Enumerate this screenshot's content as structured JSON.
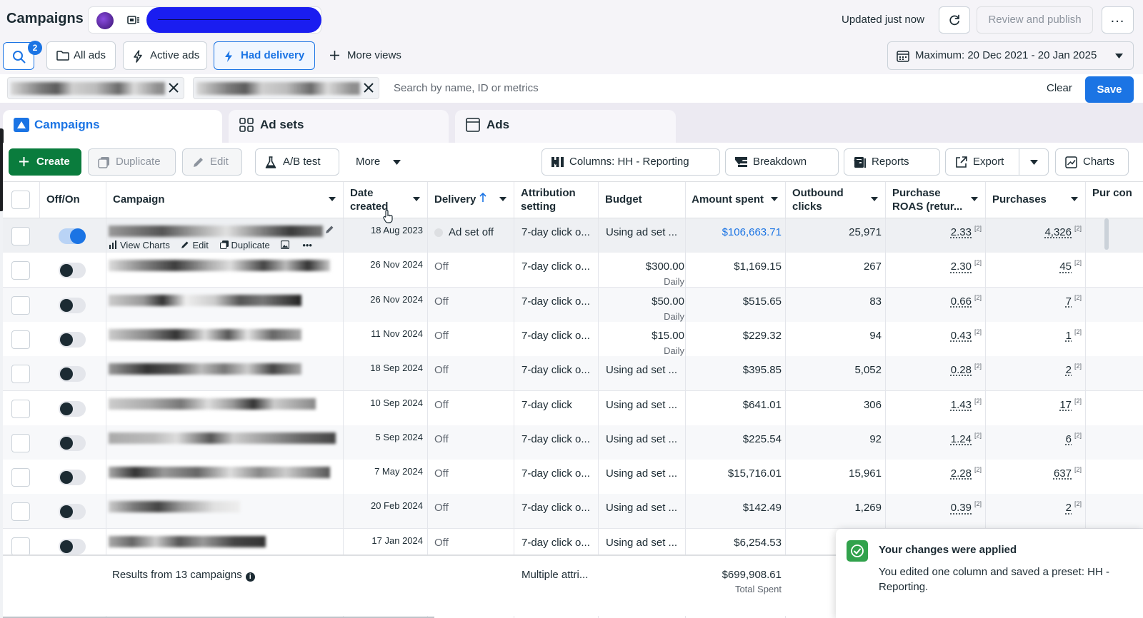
{
  "header": {
    "title": "Campaigns",
    "updated": "Updated just now",
    "review_label": "Review and publish",
    "more_label": "..."
  },
  "views": {
    "search_badge": "2",
    "all_ads": "All ads",
    "active_ads": "Active ads",
    "had_delivery": "Had delivery",
    "more_views": "More views",
    "date_range": "Maximum: 20 Dec 2021 - 20 Jan 2025"
  },
  "filters": {
    "search_placeholder": "Search by name, ID or metrics",
    "clear": "Clear",
    "save": "Save"
  },
  "tabs": {
    "campaigns": "Campaigns",
    "adsets": "Ad sets",
    "ads": "Ads"
  },
  "toolbar": {
    "create": "Create",
    "duplicate": "Duplicate",
    "edit": "Edit",
    "ab_test": "A/B test",
    "more": "More",
    "columns": "Columns: HH - Reporting",
    "breakdown": "Breakdown",
    "reports": "Reports",
    "export": "Export",
    "charts": "Charts"
  },
  "table": {
    "headers": {
      "offon": "Off/On",
      "campaign": "Campaign",
      "date_created": "Date created",
      "delivery": "Delivery",
      "attribution": "Attribution setting",
      "budget": "Budget",
      "amount_spent": "Amount spent",
      "outbound_clicks": "Outbound clicks",
      "roas": "Purchase ROAS (retur...",
      "purchases": "Purchases",
      "cut": "Pur con"
    },
    "row_actions": {
      "view_charts": "View Charts",
      "edit": "Edit",
      "duplicate": "Duplicate"
    },
    "rows": [
      {
        "on": true,
        "date": "18 Aug 2023",
        "delivery": "Ad set off",
        "attribution": "7-day click o...",
        "budget": "Using ad set ...",
        "budget_sub": "",
        "spent": "$106,663.71",
        "clicks": "25,971",
        "roas": "2.33",
        "purchases": "4,326"
      },
      {
        "on": false,
        "date": "26 Nov 2024",
        "delivery": "Off",
        "attribution": "7-day click o...",
        "budget": "$300.00",
        "budget_sub": "Daily",
        "spent": "$1,169.15",
        "clicks": "267",
        "roas": "2.30",
        "purchases": "45"
      },
      {
        "on": false,
        "date": "26 Nov 2024",
        "delivery": "Off",
        "attribution": "7-day click o...",
        "budget": "$50.00",
        "budget_sub": "Daily",
        "spent": "$515.65",
        "clicks": "83",
        "roas": "0.66",
        "purchases": "7"
      },
      {
        "on": false,
        "date": "11 Nov 2024",
        "delivery": "Off",
        "attribution": "7-day click o...",
        "budget": "$15.00",
        "budget_sub": "Daily",
        "spent": "$229.32",
        "clicks": "94",
        "roas": "0.43",
        "purchases": "1"
      },
      {
        "on": false,
        "date": "18 Sep 2024",
        "delivery": "Off",
        "attribution": "7-day click o...",
        "budget": "Using ad set ...",
        "budget_sub": "",
        "spent": "$395.85",
        "clicks": "5,052",
        "roas": "0.28",
        "purchases": "2"
      },
      {
        "on": false,
        "date": "10 Sep 2024",
        "delivery": "Off",
        "attribution": "7-day click",
        "budget": "Using ad set ...",
        "budget_sub": "",
        "spent": "$641.01",
        "clicks": "306",
        "roas": "1.43",
        "purchases": "17"
      },
      {
        "on": false,
        "date": "5 Sep 2024",
        "delivery": "Off",
        "attribution": "7-day click o...",
        "budget": "Using ad set ...",
        "budget_sub": "",
        "spent": "$225.54",
        "clicks": "92",
        "roas": "1.24",
        "purchases": "6"
      },
      {
        "on": false,
        "date": "7 May 2024",
        "delivery": "Off",
        "attribution": "7-day click o...",
        "budget": "Using ad set ...",
        "budget_sub": "",
        "spent": "$15,716.01",
        "clicks": "15,961",
        "roas": "2.28",
        "purchases": "637"
      },
      {
        "on": false,
        "date": "20 Feb 2024",
        "delivery": "Off",
        "attribution": "7-day click o...",
        "budget": "Using ad set ...",
        "budget_sub": "",
        "spent": "$142.49",
        "clicks": "1,269",
        "roas": "0.39",
        "purchases": "2"
      },
      {
        "on": false,
        "date": "17 Jan 2024",
        "delivery": "Off",
        "attribution": "7-day click o...",
        "budget": "Using ad set ...",
        "budget_sub": "",
        "spent": "$6,254.53",
        "clicks": "",
        "roas": "",
        "purchases": ""
      }
    ],
    "sup_mark": "[2]",
    "footer": {
      "results": "Results from 13 campaigns",
      "attribution": "Multiple attri...",
      "total_spent": "$699,908.61",
      "total_label": "Total Spent"
    }
  },
  "toast": {
    "title": "Your changes were applied",
    "body": "You edited one column and saved a preset: HH - Reporting."
  },
  "colors": {
    "primary": "#1b74e4",
    "create_green": "#0a7c3d",
    "success": "#31a24c"
  }
}
